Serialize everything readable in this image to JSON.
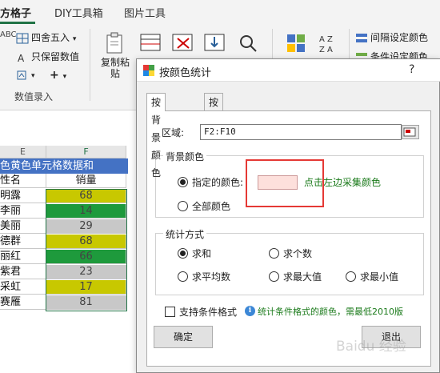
{
  "ribbon": {
    "tabs": [
      "方格子",
      "DIY工具箱",
      "图片工具"
    ],
    "group1": {
      "row1": [
        "四舍五入",
        "只保留数值"
      ],
      "label": "数值录入",
      "prefix": "ABC"
    },
    "big_button": "复制粘\n贴",
    "group2_items": [
      "间隔设定颜色",
      "条件设定颜色"
    ]
  },
  "sheet": {
    "col_headers": [
      "E",
      "F"
    ],
    "title_text": "色黄色单元格数据和",
    "header_row": {
      "name": "性名",
      "sales": "销量"
    },
    "rows": [
      {
        "name": "明露",
        "sales": "68",
        "color": "#c8c800"
      },
      {
        "name": "李丽",
        "sales": "14",
        "color": "#1e9a3c"
      },
      {
        "name": "美丽",
        "sales": "29",
        "color": "#c8c8c8"
      },
      {
        "name": "德群",
        "sales": "68",
        "color": "#c8c800"
      },
      {
        "name": "丽红",
        "sales": "66",
        "color": "#1e9a3c"
      },
      {
        "name": "紫君",
        "sales": "23",
        "color": "#c8c8c8"
      },
      {
        "name": "采虹",
        "sales": "17",
        "color": "#c8c800"
      },
      {
        "name": "赛雁",
        "sales": "81",
        "color": "#c8c8c8"
      }
    ]
  },
  "dialog": {
    "title": "按颜色统计",
    "help": "?",
    "tabs": [
      "按背景颜色",
      "按字体颜色"
    ],
    "range_label": "区域:",
    "range_value": "F2:F10",
    "bg_group_label": "背景颜色",
    "opt_specified": "指定的颜色:",
    "opt_all": "全部颜色",
    "swatch_color": "#fde0dc",
    "hint_pick": "点击左边采集颜色",
    "stat_group_label": "统计方式",
    "stat_options": [
      "求和",
      "求个数",
      "求平均数",
      "求最大值",
      "求最小值"
    ],
    "checkbox_label": "支持条件格式",
    "info_text": "统计条件格式的颜色，需最低2010版",
    "ok": "确定",
    "cancel": "退出"
  },
  "watermark": "Baidu 经验"
}
